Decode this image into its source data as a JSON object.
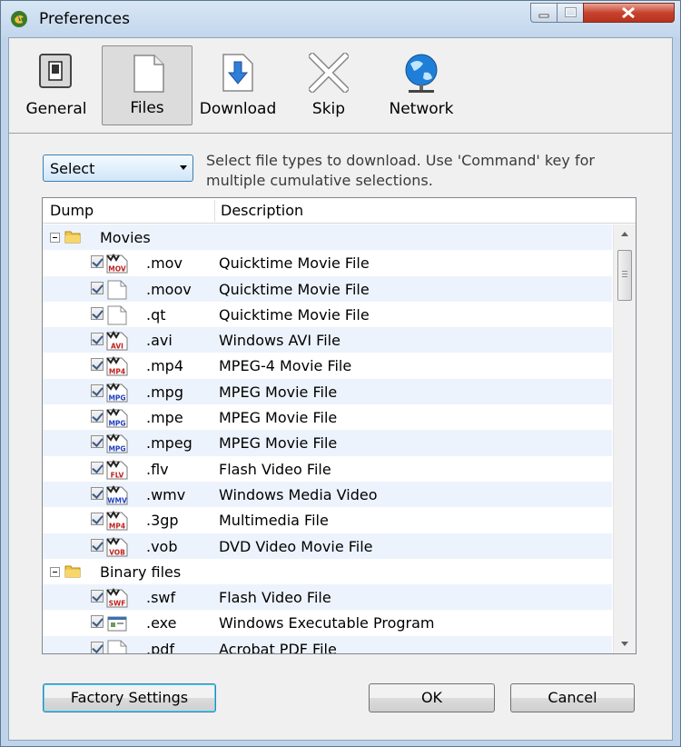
{
  "window": {
    "title": "Preferences"
  },
  "toolbar": {
    "tabs": [
      {
        "label": "General",
        "icon": "switch-icon"
      },
      {
        "label": "Files",
        "icon": "document-icon",
        "active": true
      },
      {
        "label": "Download",
        "icon": "download-arrow-icon"
      },
      {
        "label": "Skip",
        "icon": "x-cross-icon"
      },
      {
        "label": "Network",
        "icon": "globe-icon"
      }
    ]
  },
  "select": {
    "value": "Select"
  },
  "hint": "Select file types to download. Use 'Command' key for multiple cumulative selections.",
  "table": {
    "columns": [
      "Dump",
      "Description"
    ],
    "groups": [
      {
        "label": "Movies"
      },
      {
        "label": "Binary files"
      }
    ],
    "movies": [
      {
        "ext": ".mov",
        "desc": "Quicktime Movie File",
        "badge": "MOV"
      },
      {
        "ext": ".moov",
        "desc": "Quicktime Movie File",
        "badge": ""
      },
      {
        "ext": ".qt",
        "desc": "Quicktime Movie File",
        "badge": ""
      },
      {
        "ext": ".avi",
        "desc": "Windows AVI File",
        "badge": "AVI"
      },
      {
        "ext": ".mp4",
        "desc": "MPEG-4 Movie File",
        "badge": "MP4"
      },
      {
        "ext": ".mpg",
        "desc": "MPEG Movie File",
        "badge": "MPG"
      },
      {
        "ext": ".mpe",
        "desc": "MPEG Movie File",
        "badge": "MPG"
      },
      {
        "ext": ".mpeg",
        "desc": "MPEG Movie File",
        "badge": "MPG"
      },
      {
        "ext": ".flv",
        "desc": "Flash Video File",
        "badge": "FLV"
      },
      {
        "ext": ".wmv",
        "desc": "Windows Media Video",
        "badge": "WMV"
      },
      {
        "ext": ".3gp",
        "desc": "Multimedia File",
        "badge": "MP4"
      },
      {
        "ext": ".vob",
        "desc": "DVD Video Movie File",
        "badge": "VOB"
      }
    ],
    "binary": [
      {
        "ext": ".swf",
        "desc": "Flash Video File",
        "badge": "SWF"
      },
      {
        "ext": ".exe",
        "desc": "Windows Executable Program",
        "badge": "EXE"
      },
      {
        "ext": ".pdf",
        "desc": "Acrobat PDF File",
        "badge": ""
      }
    ]
  },
  "buttons": {
    "factory": "Factory Settings",
    "ok": "OK",
    "cancel": "Cancel"
  },
  "colors": {
    "accent": "#3c7fb1",
    "row_alt": "#edf3fc",
    "badge_red": "#d02020",
    "badge_blue": "#2040c0"
  }
}
